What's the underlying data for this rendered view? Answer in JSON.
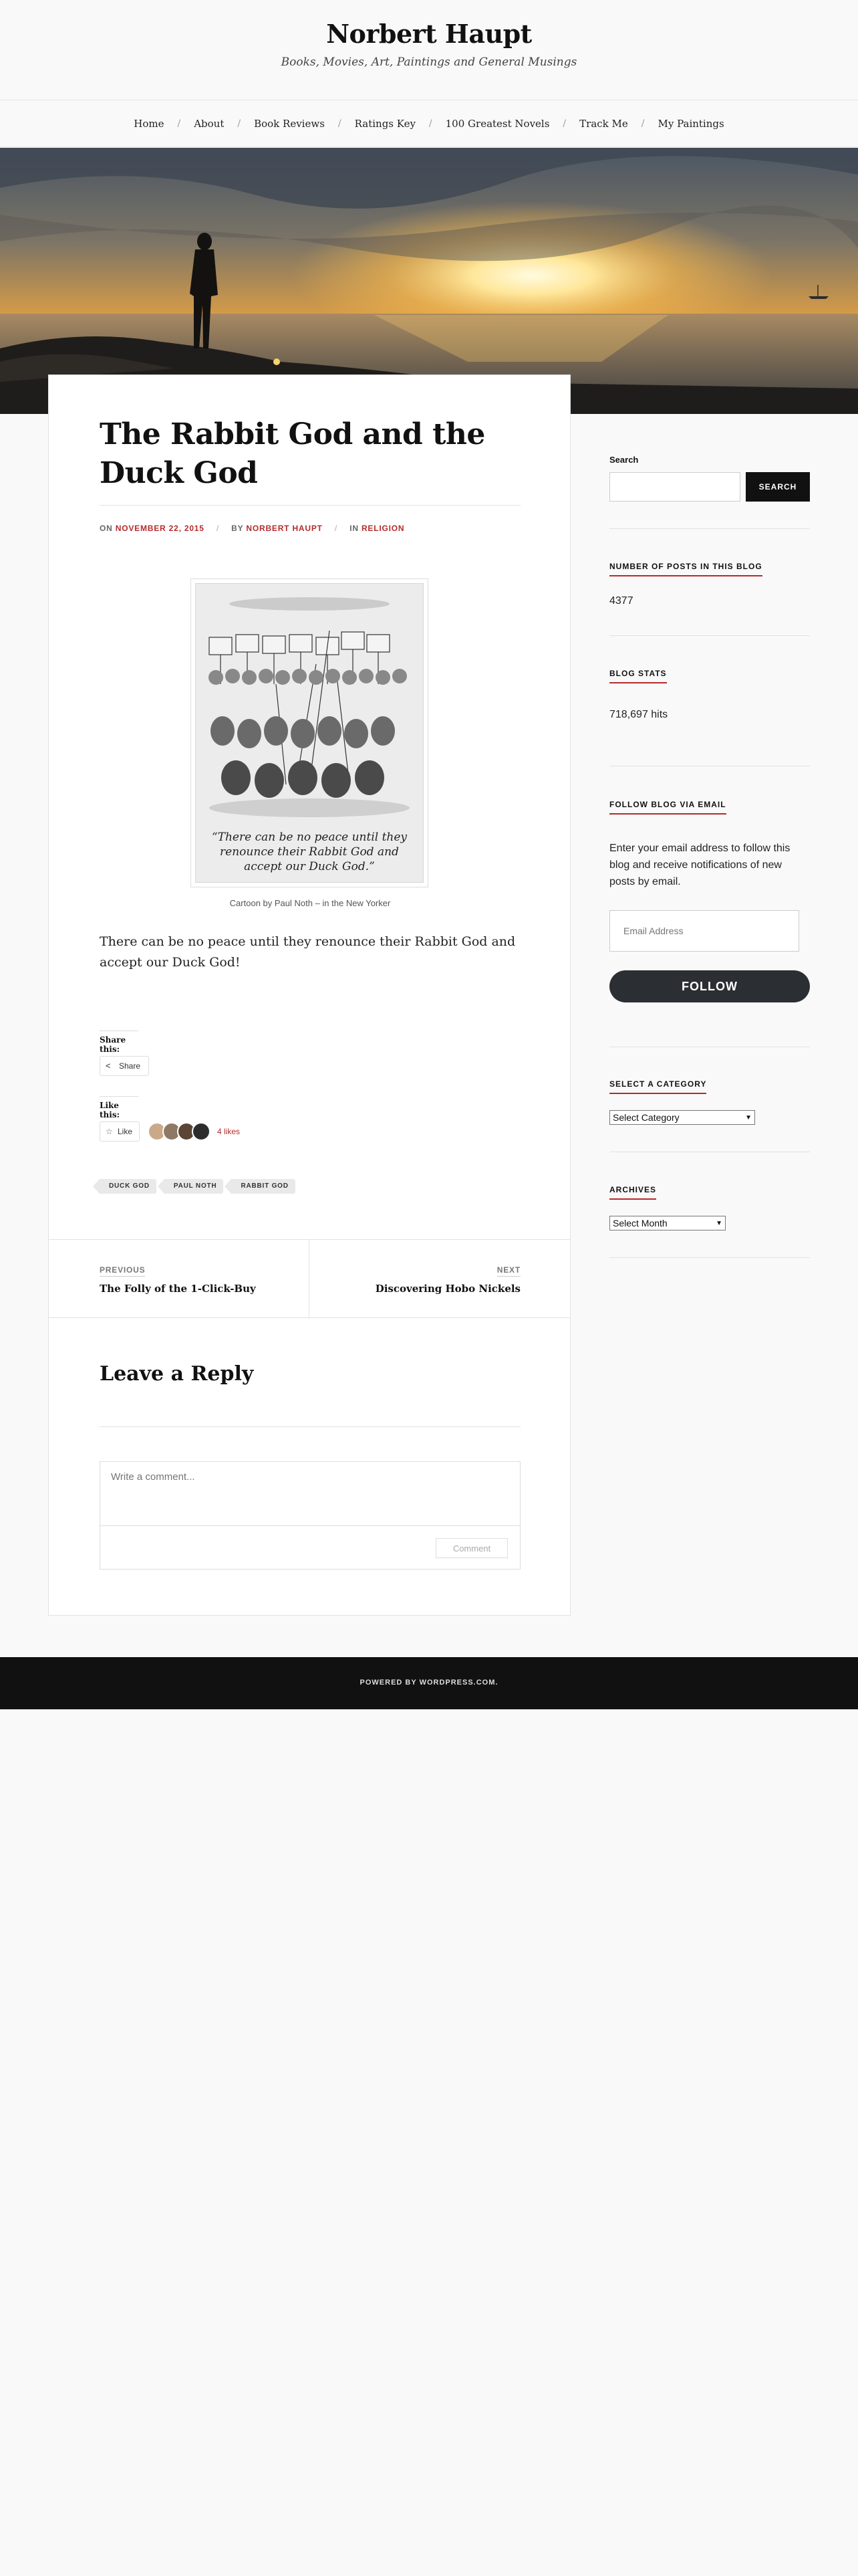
{
  "site": {
    "title": "Norbert Haupt",
    "description": "Books, Movies, Art, Paintings and General Musings"
  },
  "nav": {
    "items": [
      "Home",
      "About",
      "Book Reviews",
      "Ratings Key",
      "100 Greatest Novels",
      "Track Me",
      "My Paintings"
    ],
    "separator": "/"
  },
  "hero": {
    "image": "sunset-coast-silhouette"
  },
  "post": {
    "title": "The Rabbit God and the Duck God",
    "meta": {
      "on_label": "ON",
      "date": "NOVEMBER 22, 2015",
      "by_label": "BY",
      "author": "NORBERT HAUPT",
      "in_label": "IN",
      "category": "RELIGION"
    },
    "cartoon_quote": "“There can be no peace until they renounce their Rabbit God and accept our Duck God.”",
    "caption": "Cartoon by Paul Noth – in the New Yorker",
    "body": "There can be no peace until they renounce their Rabbit God and accept our Duck God!"
  },
  "sharing": {
    "share_heading": "Share this:",
    "share_button": "Share",
    "like_heading": "Like this:",
    "like_button": "Like",
    "likes_count": "4 likes"
  },
  "tags": [
    "DUCK GOD",
    "PAUL NOTH",
    "RABBIT GOD"
  ],
  "post_nav": {
    "previous_label": "PREVIOUS",
    "previous_title": "The Folly of the 1-Click-Buy",
    "next_label": "NEXT",
    "next_title": "Discovering Hobo Nickels"
  },
  "reply": {
    "title": "Leave a Reply",
    "placeholder": "Write a comment...",
    "submit": "Comment"
  },
  "sidebar": {
    "search_label": "Search",
    "search_button": "SEARCH",
    "posts_count_title": "NUMBER OF POSTS IN THIS BLOG",
    "posts_count": "4377",
    "stats_title": "BLOG STATS",
    "stats_value": "718,697 hits",
    "follow_title": "FOLLOW BLOG VIA EMAIL",
    "follow_text": "Enter your email address to follow this blog and receive notifications of new posts by email.",
    "email_placeholder": "Email Address",
    "follow_button": "FOLLOW",
    "category_title": "SELECT A CATEGORY",
    "category_select": "Select Category",
    "archives_title": "ARCHIVES",
    "archives_select": "Select Month"
  },
  "footer": {
    "text": "POWERED BY WORDPRESS.COM."
  },
  "colors": {
    "accent": "#b52b2b",
    "footer_bg": "#111111",
    "follow_bg": "#2b2e32"
  }
}
